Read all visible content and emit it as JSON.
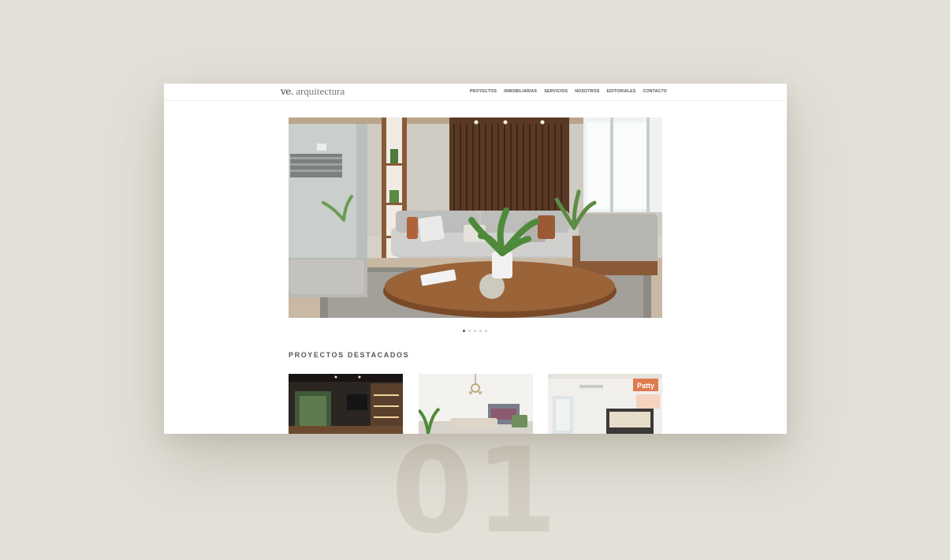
{
  "showcase": {
    "number": "01"
  },
  "site": {
    "logo_mark": "ve.",
    "logo_text": "arquitectura",
    "nav": [
      "PROYECTOS",
      "INMOBILIARIAS",
      "SERVICIOS",
      "NOSOTROS",
      "EDITORIALES",
      "CONTACTO"
    ]
  },
  "hero": {
    "slides_total": 5,
    "active_slide": 1
  },
  "featured": {
    "title": "PROYECTOS DESTACADOS",
    "card_signage": "Patty"
  }
}
